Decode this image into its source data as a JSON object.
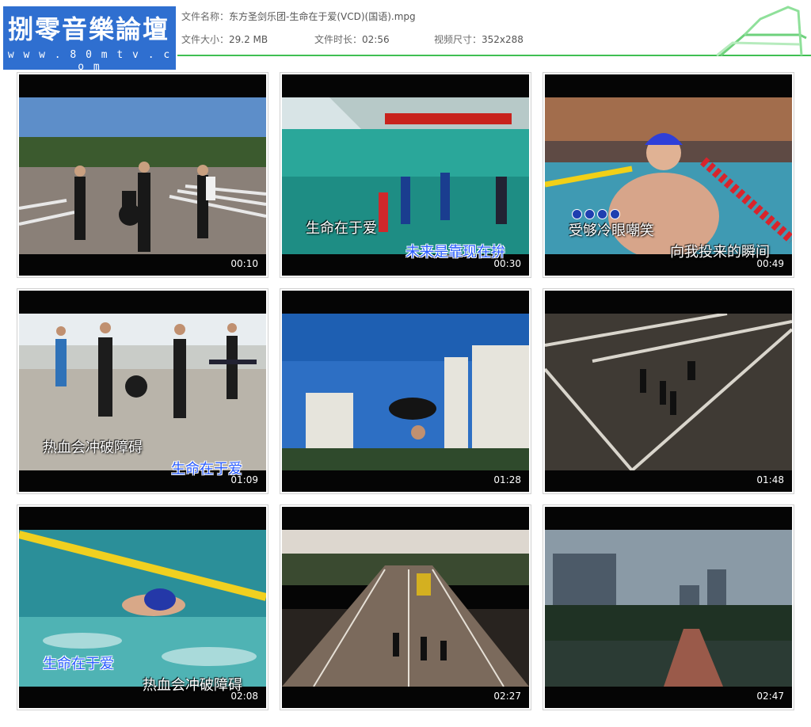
{
  "logo": {
    "title": "捌零音樂論壇",
    "url": "w w w . 8 0 m t v . c o m"
  },
  "file_info": {
    "name_label": "文件名称：",
    "name_value": "东方圣剑乐团-生命在于爱(VCD)(国语).mpg",
    "size_label": "文件大小：",
    "size_value": "29.2 MB",
    "duration_label": "文件时长：",
    "duration_value": "02:56",
    "dims_label": "视频尺寸：",
    "dims_value": "352x288"
  },
  "colors": {
    "accent_green": "#3fbf52",
    "logo_blue": "#2f6fd0",
    "lyric_blue": "#2a5cff"
  },
  "thumbnails": [
    {
      "time": "00:10",
      "lyrics": []
    },
    {
      "time": "00:30",
      "lyrics": [
        "生命在于爱",
        "未来是靠现在拚"
      ]
    },
    {
      "time": "00:49",
      "lyrics": [
        "受够冷眼嘲笑",
        "向我投来的瞬间"
      ]
    },
    {
      "time": "01:09",
      "lyrics": [
        "热血会冲破障碍",
        "生命在于爱"
      ]
    },
    {
      "time": "01:28",
      "lyrics": []
    },
    {
      "time": "01:48",
      "lyrics": []
    },
    {
      "time": "02:08",
      "lyrics": [
        "生命在于爱",
        "热血会冲破障碍"
      ]
    },
    {
      "time": "02:27",
      "lyrics": []
    },
    {
      "time": "02:47",
      "lyrics": []
    }
  ]
}
